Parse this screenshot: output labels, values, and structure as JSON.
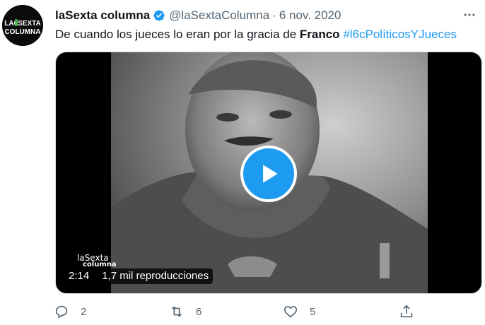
{
  "tweet": {
    "author_name": "laSexta columna",
    "handle": "@laSextaColumna",
    "separator": "·",
    "date": "6 nov. 2020",
    "text_plain": "De cuando los jueces lo eran por la gracia de ",
    "text_bold": "Franco",
    "hashtag": "#l6cPolíticosYJueces",
    "verified": true,
    "avatar_logo_line1": "LA6SEXTA",
    "avatar_logo_line2": "COLUMNA"
  },
  "media": {
    "duration": "2:14",
    "views": "1,7 mil reproducciones",
    "watermark_line1": "laSexta",
    "watermark_line2": "columna",
    "play_icon": "play-icon"
  },
  "actions": {
    "replies": "2",
    "retweets": "6",
    "likes": "5"
  },
  "colors": {
    "accent": "#1d9bf0",
    "muted": "#536471",
    "text": "#0f1419"
  }
}
